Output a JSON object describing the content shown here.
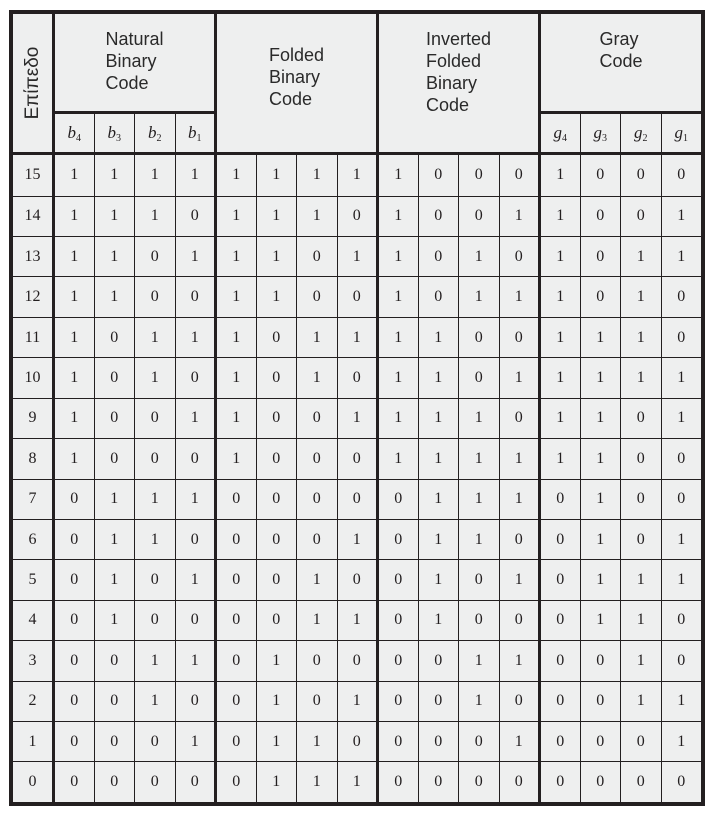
{
  "table": {
    "level_header": "Επίπεδο",
    "groups": [
      {
        "key": "natural",
        "title_lines": [
          "Natural",
          "Binary",
          "Code"
        ],
        "subheaders": [
          {
            "sym": "b",
            "sub": "4"
          },
          {
            "sym": "b",
            "sub": "3"
          },
          {
            "sym": "b",
            "sub": "2"
          },
          {
            "sym": "b",
            "sub": "1"
          }
        ]
      },
      {
        "key": "folded",
        "title_lines": [
          "Folded",
          "Binary",
          "Code"
        ],
        "subheaders": []
      },
      {
        "key": "inverted_folded",
        "title_lines": [
          "Inverted",
          "Folded",
          "Binary",
          "Code"
        ],
        "subheaders": []
      },
      {
        "key": "gray",
        "title_lines": [
          "Gray",
          "Code"
        ],
        "subheaders": [
          {
            "sym": "g",
            "sub": "4"
          },
          {
            "sym": "g",
            "sub": "3"
          },
          {
            "sym": "g",
            "sub": "2"
          },
          {
            "sym": "g",
            "sub": "1"
          }
        ]
      }
    ],
    "rows": [
      {
        "level": "15",
        "natural": [
          "1",
          "1",
          "1",
          "1"
        ],
        "folded": [
          "1",
          "1",
          "1",
          "1"
        ],
        "inverted_folded": [
          "1",
          "0",
          "0",
          "0"
        ],
        "gray": [
          "1",
          "0",
          "0",
          "0"
        ]
      },
      {
        "level": "14",
        "natural": [
          "1",
          "1",
          "1",
          "0"
        ],
        "folded": [
          "1",
          "1",
          "1",
          "0"
        ],
        "inverted_folded": [
          "1",
          "0",
          "0",
          "1"
        ],
        "gray": [
          "1",
          "0",
          "0",
          "1"
        ]
      },
      {
        "level": "13",
        "natural": [
          "1",
          "1",
          "0",
          "1"
        ],
        "folded": [
          "1",
          "1",
          "0",
          "1"
        ],
        "inverted_folded": [
          "1",
          "0",
          "1",
          "0"
        ],
        "gray": [
          "1",
          "0",
          "1",
          "1"
        ]
      },
      {
        "level": "12",
        "natural": [
          "1",
          "1",
          "0",
          "0"
        ],
        "folded": [
          "1",
          "1",
          "0",
          "0"
        ],
        "inverted_folded": [
          "1",
          "0",
          "1",
          "1"
        ],
        "gray": [
          "1",
          "0",
          "1",
          "0"
        ]
      },
      {
        "level": "11",
        "natural": [
          "1",
          "0",
          "1",
          "1"
        ],
        "folded": [
          "1",
          "0",
          "1",
          "1"
        ],
        "inverted_folded": [
          "1",
          "1",
          "0",
          "0"
        ],
        "gray": [
          "1",
          "1",
          "1",
          "0"
        ]
      },
      {
        "level": "10",
        "natural": [
          "1",
          "0",
          "1",
          "0"
        ],
        "folded": [
          "1",
          "0",
          "1",
          "0"
        ],
        "inverted_folded": [
          "1",
          "1",
          "0",
          "1"
        ],
        "gray": [
          "1",
          "1",
          "1",
          "1"
        ]
      },
      {
        "level": "9",
        "natural": [
          "1",
          "0",
          "0",
          "1"
        ],
        "folded": [
          "1",
          "0",
          "0",
          "1"
        ],
        "inverted_folded": [
          "1",
          "1",
          "1",
          "0"
        ],
        "gray": [
          "1",
          "1",
          "0",
          "1"
        ]
      },
      {
        "level": "8",
        "natural": [
          "1",
          "0",
          "0",
          "0"
        ],
        "folded": [
          "1",
          "0",
          "0",
          "0"
        ],
        "inverted_folded": [
          "1",
          "1",
          "1",
          "1"
        ],
        "gray": [
          "1",
          "1",
          "0",
          "0"
        ]
      },
      {
        "level": "7",
        "natural": [
          "0",
          "1",
          "1",
          "1"
        ],
        "folded": [
          "0",
          "0",
          "0",
          "0"
        ],
        "inverted_folded": [
          "0",
          "1",
          "1",
          "1"
        ],
        "gray": [
          "0",
          "1",
          "0",
          "0"
        ]
      },
      {
        "level": "6",
        "natural": [
          "0",
          "1",
          "1",
          "0"
        ],
        "folded": [
          "0",
          "0",
          "0",
          "1"
        ],
        "inverted_folded": [
          "0",
          "1",
          "1",
          "0"
        ],
        "gray": [
          "0",
          "1",
          "0",
          "1"
        ]
      },
      {
        "level": "5",
        "natural": [
          "0",
          "1",
          "0",
          "1"
        ],
        "folded": [
          "0",
          "0",
          "1",
          "0"
        ],
        "inverted_folded": [
          "0",
          "1",
          "0",
          "1"
        ],
        "gray": [
          "0",
          "1",
          "1",
          "1"
        ]
      },
      {
        "level": "4",
        "natural": [
          "0",
          "1",
          "0",
          "0"
        ],
        "folded": [
          "0",
          "0",
          "1",
          "1"
        ],
        "inverted_folded": [
          "0",
          "1",
          "0",
          "0"
        ],
        "gray": [
          "0",
          "1",
          "1",
          "0"
        ]
      },
      {
        "level": "3",
        "natural": [
          "0",
          "0",
          "1",
          "1"
        ],
        "folded": [
          "0",
          "1",
          "0",
          "0"
        ],
        "inverted_folded": [
          "0",
          "0",
          "1",
          "1"
        ],
        "gray": [
          "0",
          "0",
          "1",
          "0"
        ]
      },
      {
        "level": "2",
        "natural": [
          "0",
          "0",
          "1",
          "0"
        ],
        "folded": [
          "0",
          "1",
          "0",
          "1"
        ],
        "inverted_folded": [
          "0",
          "0",
          "1",
          "0"
        ],
        "gray": [
          "0",
          "0",
          "1",
          "1"
        ]
      },
      {
        "level": "1",
        "natural": [
          "0",
          "0",
          "0",
          "1"
        ],
        "folded": [
          "0",
          "1",
          "1",
          "0"
        ],
        "inverted_folded": [
          "0",
          "0",
          "0",
          "1"
        ],
        "gray": [
          "0",
          "0",
          "0",
          "1"
        ]
      },
      {
        "level": "0",
        "natural": [
          "0",
          "0",
          "0",
          "0"
        ],
        "folded": [
          "0",
          "1",
          "1",
          "1"
        ],
        "inverted_folded": [
          "0",
          "0",
          "0",
          "0"
        ],
        "gray": [
          "0",
          "0",
          "0",
          "0"
        ]
      }
    ]
  }
}
